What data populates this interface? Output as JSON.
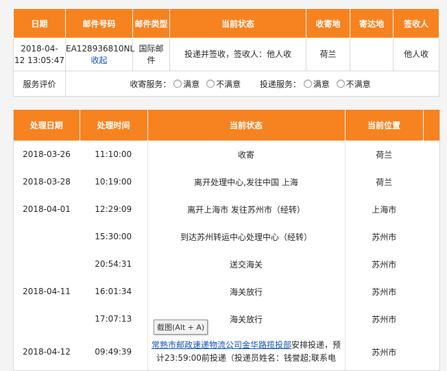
{
  "summary": {
    "headers": [
      "日期",
      "邮件号码",
      "邮件类型",
      "当前状态",
      "收寄地",
      "寄达地",
      "签收人"
    ],
    "row": {
      "date": "2018-04-",
      "time": "12 13:05:47",
      "mail_no": "EA128936810NL",
      "collapse_link": "收起",
      "type_line1": "国际邮",
      "type_line2": "件",
      "status": "投递并签收，签收人：他人收",
      "origin": "荷兰",
      "destination": "",
      "signer": "他人收"
    },
    "evaluation": {
      "label": "服务评价",
      "collect_label": "收寄服务：",
      "deliver_label": "投递服务：",
      "option_satisfied": "满意",
      "option_unsatisfied": "不满意"
    }
  },
  "tracking": {
    "headers": [
      "处理日期",
      "处理时间",
      "当前状态",
      "当前位置"
    ],
    "rows": [
      {
        "date": "2018-03-26",
        "time": "11:10:00",
        "status": "收寄",
        "location": "荷兰"
      },
      {
        "date": "2018-03-28",
        "time": "10:19:00",
        "status": "离开处理中心,发往中国 上海",
        "location": "荷兰"
      },
      {
        "date": "2018-04-01",
        "time": "12:29:09",
        "status": "离开上海市 发往苏州市（经转）",
        "location": "上海市"
      },
      {
        "date": "",
        "time": "15:30:00",
        "status": "到达苏州转运中心处理中心（经转）",
        "location": "苏州市"
      },
      {
        "date": "",
        "time": "20:54:31",
        "status": "送交海关",
        "location": "苏州市"
      },
      {
        "date": "2018-04-11",
        "time": "16:01:34",
        "status": "海关放行",
        "location": "苏州市"
      },
      {
        "date": "",
        "time": "17:07:13",
        "status": "海关放行",
        "location": "苏州市"
      }
    ],
    "last_row": {
      "date": "2018-04-12",
      "time": "09:49:39",
      "status_link": "常熟市邮政速递物流公司金华路揽投部",
      "status_text1": "安排投递，预",
      "status_text2": "计23:59:00前投递（投递员姓名：钱誉超;联系电",
      "location": "苏州市"
    }
  },
  "tooltip": "截图(Alt + A)"
}
